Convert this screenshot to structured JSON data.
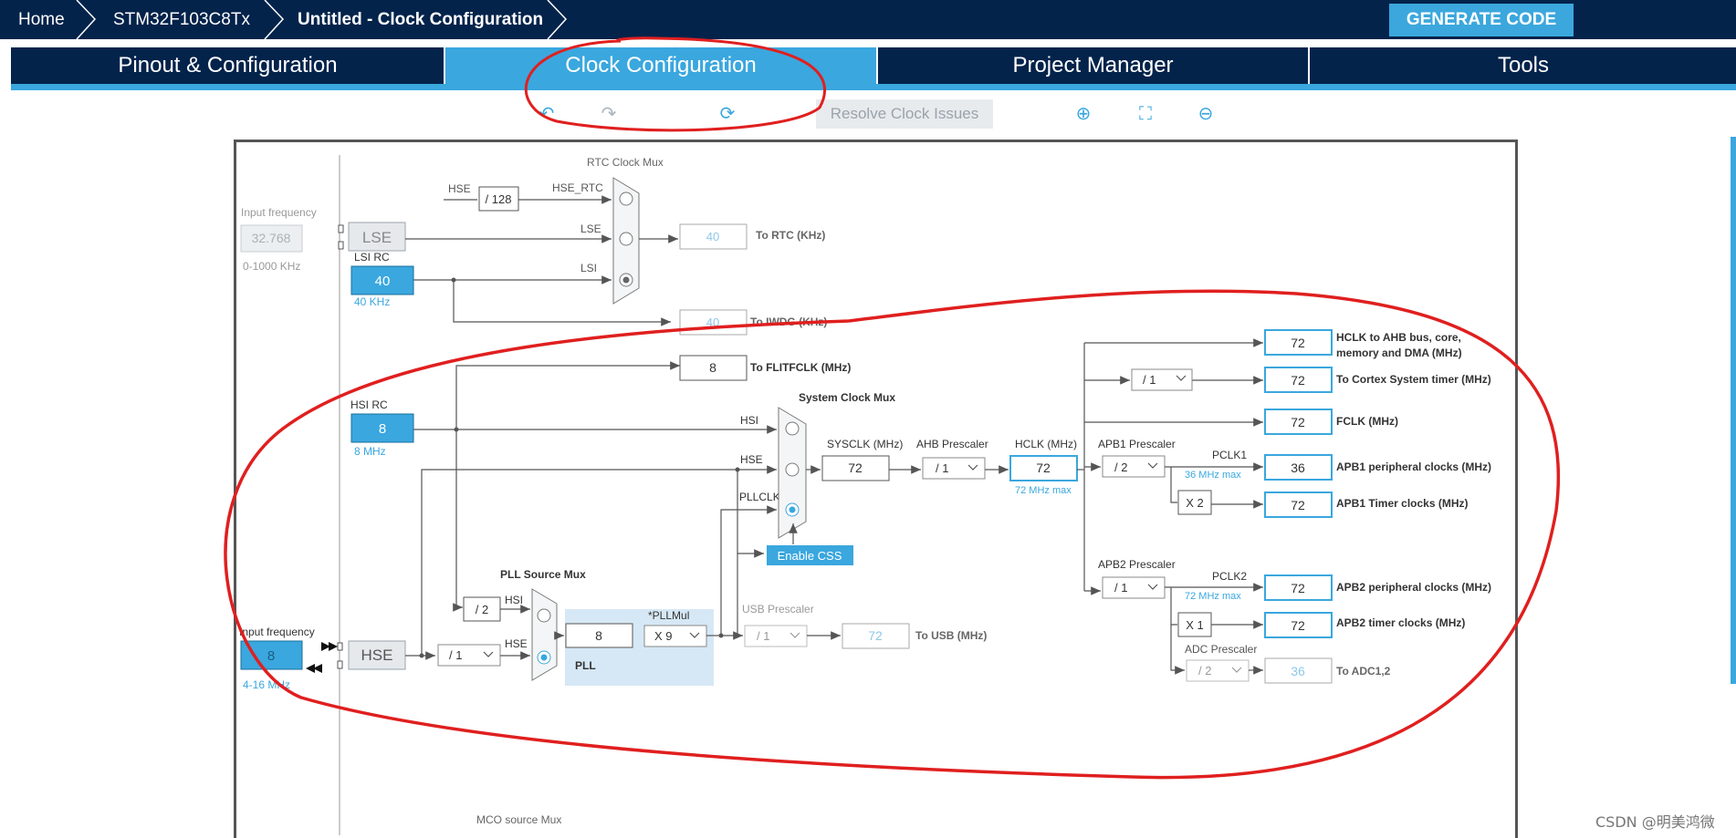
{
  "breadcrumb": [
    "Home",
    "STM32F103C8Tx",
    "Untitled - Clock Configuration"
  ],
  "generate_button": "GENERATE CODE",
  "tabs": [
    "Pinout & Configuration",
    "Clock Configuration",
    "Project Manager",
    "Tools"
  ],
  "active_tab": "Clock Configuration",
  "toolbar": {
    "resolve_label": "Resolve Clock Issues",
    "icons": [
      "undo-icon",
      "redo-icon",
      "refresh-icon",
      "zoom-in-icon",
      "fit-screen-icon",
      "zoom-out-icon"
    ]
  },
  "colors": {
    "navy": "#03234b",
    "accent": "#3aa7de",
    "annotation": "#e01f1f"
  },
  "diagram": {
    "input_freq_label": "Input frequency",
    "lse_freq": "32.768",
    "lse_range": "0-1000 KHz",
    "lse_label": "LSE",
    "lsi_rc_label": "LSI RC",
    "lsi_value": "40",
    "lsi_unit": "40 KHz",
    "rtc_mux_title": "RTC Clock Mux",
    "hse_label": "HSE",
    "div128": "/ 128",
    "hse_rtc": "HSE_RTC",
    "lsi_label": "LSI",
    "rtc_out": "40",
    "rtc_out_label": "To RTC (KHz)",
    "iwdg_out": "40",
    "iwdg_out_label": "To IWDG (KHz)",
    "flit_out": "8",
    "flit_out_label": "To FLITFCLK (MHz)",
    "hsi_rc_label": "HSI RC",
    "hsi_value": "8",
    "hsi_unit": "8 MHz",
    "sys_mux_title": "System Clock Mux",
    "hsi_label": "HSI",
    "pllclk_label": "PLLCLK",
    "enable_css": "Enable CSS",
    "sysclk_label": "SYSCLK (MHz)",
    "sysclk": "72",
    "ahb_label": "AHB Prescaler",
    "ahb": "/ 1",
    "hclk_label": "HCLK (MHz)",
    "hclk": "72",
    "hclk_max": "72 MHz max",
    "hclk_ahb_out": "72",
    "hclk_ahb_label": "HCLK to AHB bus, core,",
    "hclk_ahb_label2": "memory and DMA (MHz)",
    "cortex_div": "/ 1",
    "cortex_out": "72",
    "cortex_label": "To Cortex System timer (MHz)",
    "fclk_out": "72",
    "fclk_label": "FCLK (MHz)",
    "apb1_label": "APB1 Prescaler",
    "apb1": "/ 2",
    "pclk1_label": "PCLK1",
    "pclk1_max": "36 MHz max",
    "apb1_periph": "36",
    "apb1_periph_label": "APB1 peripheral clocks (MHz)",
    "apb1_x": "X 2",
    "apb1_timer": "72",
    "apb1_timer_label": "APB1 Timer clocks (MHz)",
    "apb2_label": "APB2 Prescaler",
    "apb2": "/ 1",
    "pclk2_label": "PCLK2",
    "pclk2_max": "72 MHz max",
    "apb2_periph": "72",
    "apb2_periph_label": "APB2 peripheral clocks (MHz)",
    "apb2_x": "X 1",
    "apb2_timer": "72",
    "apb2_timer_label": "APB2 timer clocks (MHz)",
    "adc_label": "ADC Prescaler",
    "adc_div": "/ 2",
    "adc_out": "36",
    "adc_out_label": "To ADC1,2",
    "pll_mux_title": "PLL Source Mux",
    "div2": "/ 2",
    "hse_freq": "8",
    "hse_range": "4-16 MHz",
    "hse_div": "/ 1",
    "pll_in": "8",
    "pll_mul_label": "*PLLMul",
    "pll_mul": "X 9",
    "pll_label": "PLL",
    "usb_label": "USB Prescaler",
    "usb_div": "/ 1",
    "usb_out": "72",
    "usb_out_label": "To USB (MHz)",
    "mco_label": "MCO source Mux"
  },
  "watermark": "CSDN @明美鸿微"
}
